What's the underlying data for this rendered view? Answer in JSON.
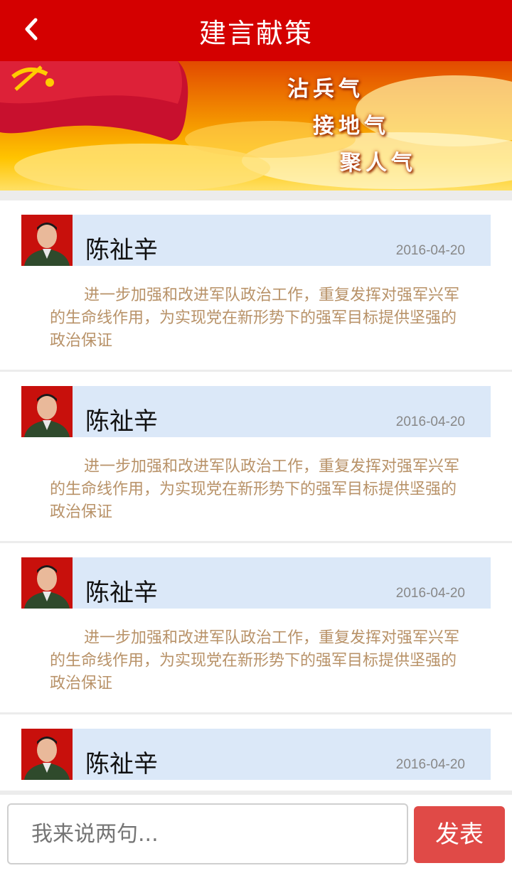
{
  "header": {
    "title": "建言献策",
    "back_icon": "chevron-left-icon"
  },
  "banner": {
    "slogans": [
      "沾兵气",
      "接地气",
      "聚人气"
    ]
  },
  "posts": [
    {
      "name": "陈祉辛",
      "date": "2016-04-20",
      "text": "进一步加强和改进军队政治工作，重复发挥对强军兴军的生命线作用，为实现党在新形势下的强军目标提供坚强的政治保证"
    },
    {
      "name": "陈祉辛",
      "date": "2016-04-20",
      "text": "进一步加强和改进军队政治工作，重复发挥对强军兴军的生命线作用，为实现党在新形势下的强军目标提供坚强的政治保证"
    },
    {
      "name": "陈祉辛",
      "date": "2016-04-20",
      "text": "进一步加强和改进军队政治工作，重复发挥对强军兴军的生命线作用，为实现党在新形势下的强军目标提供坚强的政治保证"
    },
    {
      "name": "陈祉辛",
      "date": "2016-04-20",
      "text": ""
    }
  ],
  "composer": {
    "placeholder": "我来说两句...",
    "send_label": "发表"
  },
  "colors": {
    "accent": "#d40000",
    "send": "#e04a47",
    "card_header": "#dbe8f8",
    "post_text": "#b89268"
  }
}
